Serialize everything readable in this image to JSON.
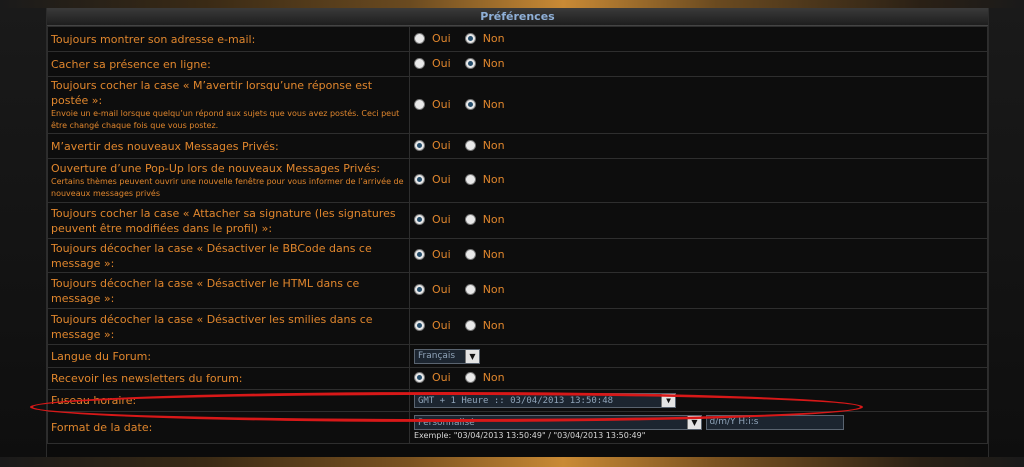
{
  "header": {
    "title": "Préférences"
  },
  "options": {
    "yes": "Oui",
    "no": "Non"
  },
  "rows": [
    {
      "label": "Toujours montrer son adresse e-mail:",
      "sub": "",
      "value": "no"
    },
    {
      "label": "Cacher sa présence en ligne:",
      "sub": "",
      "value": "no"
    },
    {
      "label": "Toujours cocher la case « M’avertir lorsqu’une réponse est postée »:",
      "sub": "Envoie un e-mail lorsque quelqu’un répond aux sujets que vous avez postés. Ceci peut être changé chaque fois que vous postez.",
      "value": "no"
    },
    {
      "label": "M’avertir des nouveaux Messages Privés:",
      "sub": "",
      "value": "yes"
    },
    {
      "label": "Ouverture d’une Pop-Up lors de nouveaux Messages Privés:",
      "sub": "Certains thèmes peuvent ouvrir une nouvelle fenêtre pour vous informer de l’arrivée de nouveaux messages privés",
      "value": "yes"
    },
    {
      "label": "Toujours cocher la case « Attacher sa signature (les signatures peuvent être modifiées dans le profil) »:",
      "sub": "",
      "value": "yes"
    },
    {
      "label": "Toujours décocher la case « Désactiver le BBCode dans ce message »:",
      "sub": "",
      "value": "yes"
    },
    {
      "label": "Toujours décocher la case « Désactiver le HTML dans ce message »:",
      "sub": "",
      "value": "yes"
    },
    {
      "label": "Toujours décocher la case « Désactiver les smilies dans ce message »:",
      "sub": "",
      "value": "yes"
    }
  ],
  "language": {
    "label": "Langue du Forum:",
    "selected": "Français"
  },
  "newsletter": {
    "label": "Recevoir les newsletters du forum:",
    "value": "yes"
  },
  "timezone": {
    "label": "Fuseau horaire:",
    "selected": "GMT + 1 Heure      :: 03/04/2013 13:50:48"
  },
  "dateformat": {
    "label": "Format de la date:",
    "selected": "Personnalisé",
    "custom": "d/m/Y H:i:s",
    "example": "Exemple: \"03/04/2013 13:50:49\" / \"03/04/2013 13:50:49\""
  }
}
